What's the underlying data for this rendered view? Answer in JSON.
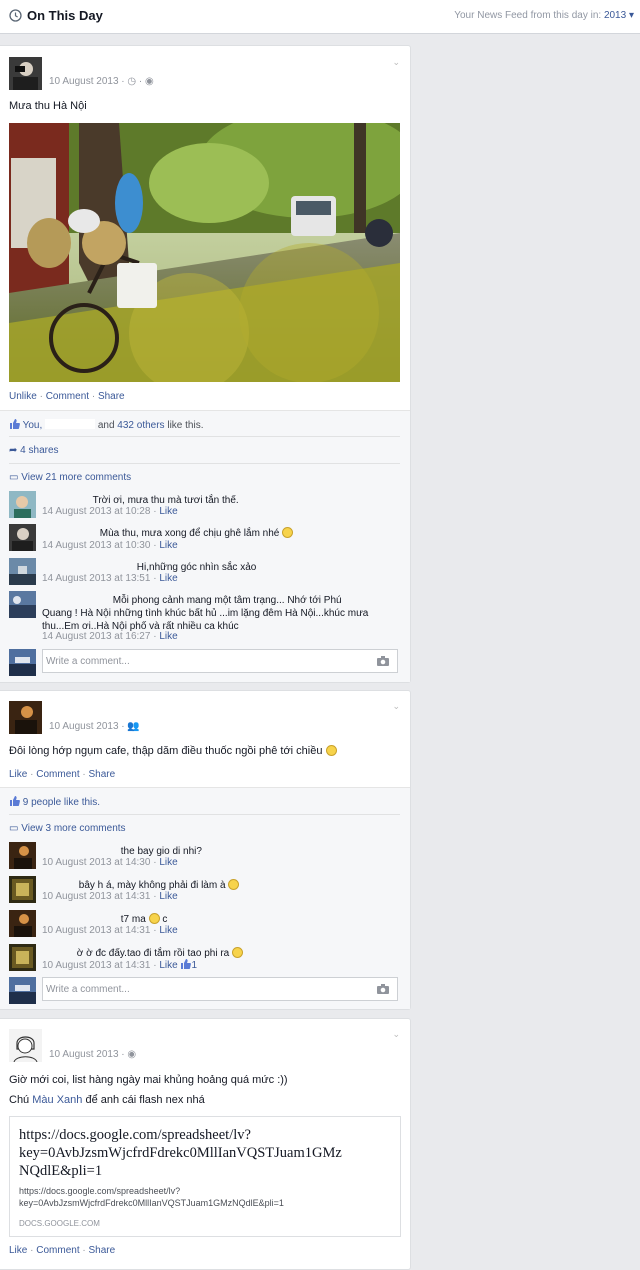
{
  "header": {
    "title": "On This Day",
    "right_prefix": "Your News Feed from this day in:",
    "year": "2013"
  },
  "post1": {
    "date": "10 August 2013",
    "text": "Mưa thu Hà Nội",
    "actions": {
      "unlike": "Unlike",
      "comment": "Comment",
      "share": "Share"
    },
    "likes_prefix": "You,",
    "likes_and": "and",
    "likes_others": "432 others",
    "likes_suffix": "like this.",
    "shares": "4 shares",
    "more_comments": "View 21 more comments",
    "comments": [
      {
        "text": "Trời ơi, mưa thu mà tươi tắn thế.",
        "time": "14 August 2013 at 10:28",
        "like": "Like"
      },
      {
        "text": "Mùa thu, mưa xong để chịu ghê lắm nhé",
        "time": "14 August 2013 at 10:30",
        "like": "Like"
      },
      {
        "text": "Hi,những góc nhìn sắc xảo",
        "time": "14 August 2013 at 13:51",
        "like": "Like"
      },
      {
        "text1": "Mỗi phong cảnh mang một tâm trạng... Nhớ tới Phú",
        "text2": "Quang ! Hà Nội những tình khúc bất hủ ...im lặng đêm Hà Nội...khúc mưa",
        "text3": "thu...Em ơi..Hà Nội phố và rất nhiều ca khúc",
        "time": "14 August 2013 at 16:27",
        "like": "Like"
      }
    ],
    "write_placeholder": "Write a comment..."
  },
  "post2": {
    "date": "10 August 2013",
    "text": "Đôi lòng hớp ngụm cafe, thập dăm điều thuốc ngồi phê tới chiều",
    "actions": {
      "like": "Like",
      "comment": "Comment",
      "share": "Share"
    },
    "likes": "9 people like this.",
    "more_comments": "View 3 more comments",
    "comments": [
      {
        "text": "the bay gio di nhi?",
        "time": "10 August 2013 at 14:30",
        "like": "Like"
      },
      {
        "text": "bây h á, mày không phải đi làm à",
        "time": "10 August 2013 at 14:31",
        "like": "Like"
      },
      {
        "text": "t7 ma",
        "text_after": "c",
        "time": "10 August 2013 at 14:31",
        "like": "Like"
      },
      {
        "text": "ờ ờ đc đấy.tao đi tắm rồi tao phi ra",
        "time": "10 August 2013 at 14:31",
        "like": "Like",
        "like_count": "1"
      }
    ],
    "write_placeholder": "Write a comment..."
  },
  "post3": {
    "date": "10 August 2013",
    "text1": "Giờ mới coi, list hàng ngày mai khủng hoảng quá mức :))",
    "text2_prefix": "Chú",
    "text2_link": "Màu Xanh",
    "text2_suffix": "để anh cái flash nex nhá",
    "link_title1": "https://docs.google.com/spreadsheet/lv?",
    "link_title2": "key=0AvbJzsmWjcfrdFdrekc0MllIanVQSTJuam1GMz",
    "link_title3": "NQdlE&pli=1",
    "link_url1": "https://docs.google.com/spreadsheet/lv?",
    "link_url2": "key=0AvbJzsmWjcfrdFdrekc0MllIanVQSTJuam1GMzNQdlE&pli=1",
    "link_domain": "DOCS.GOOGLE.COM",
    "actions": {
      "like": "Like",
      "comment": "Comment",
      "share": "Share"
    }
  },
  "colors": {
    "link": "#3b5998",
    "bg": "#e9eaed",
    "ufi_bg": "#f6f7f9"
  }
}
